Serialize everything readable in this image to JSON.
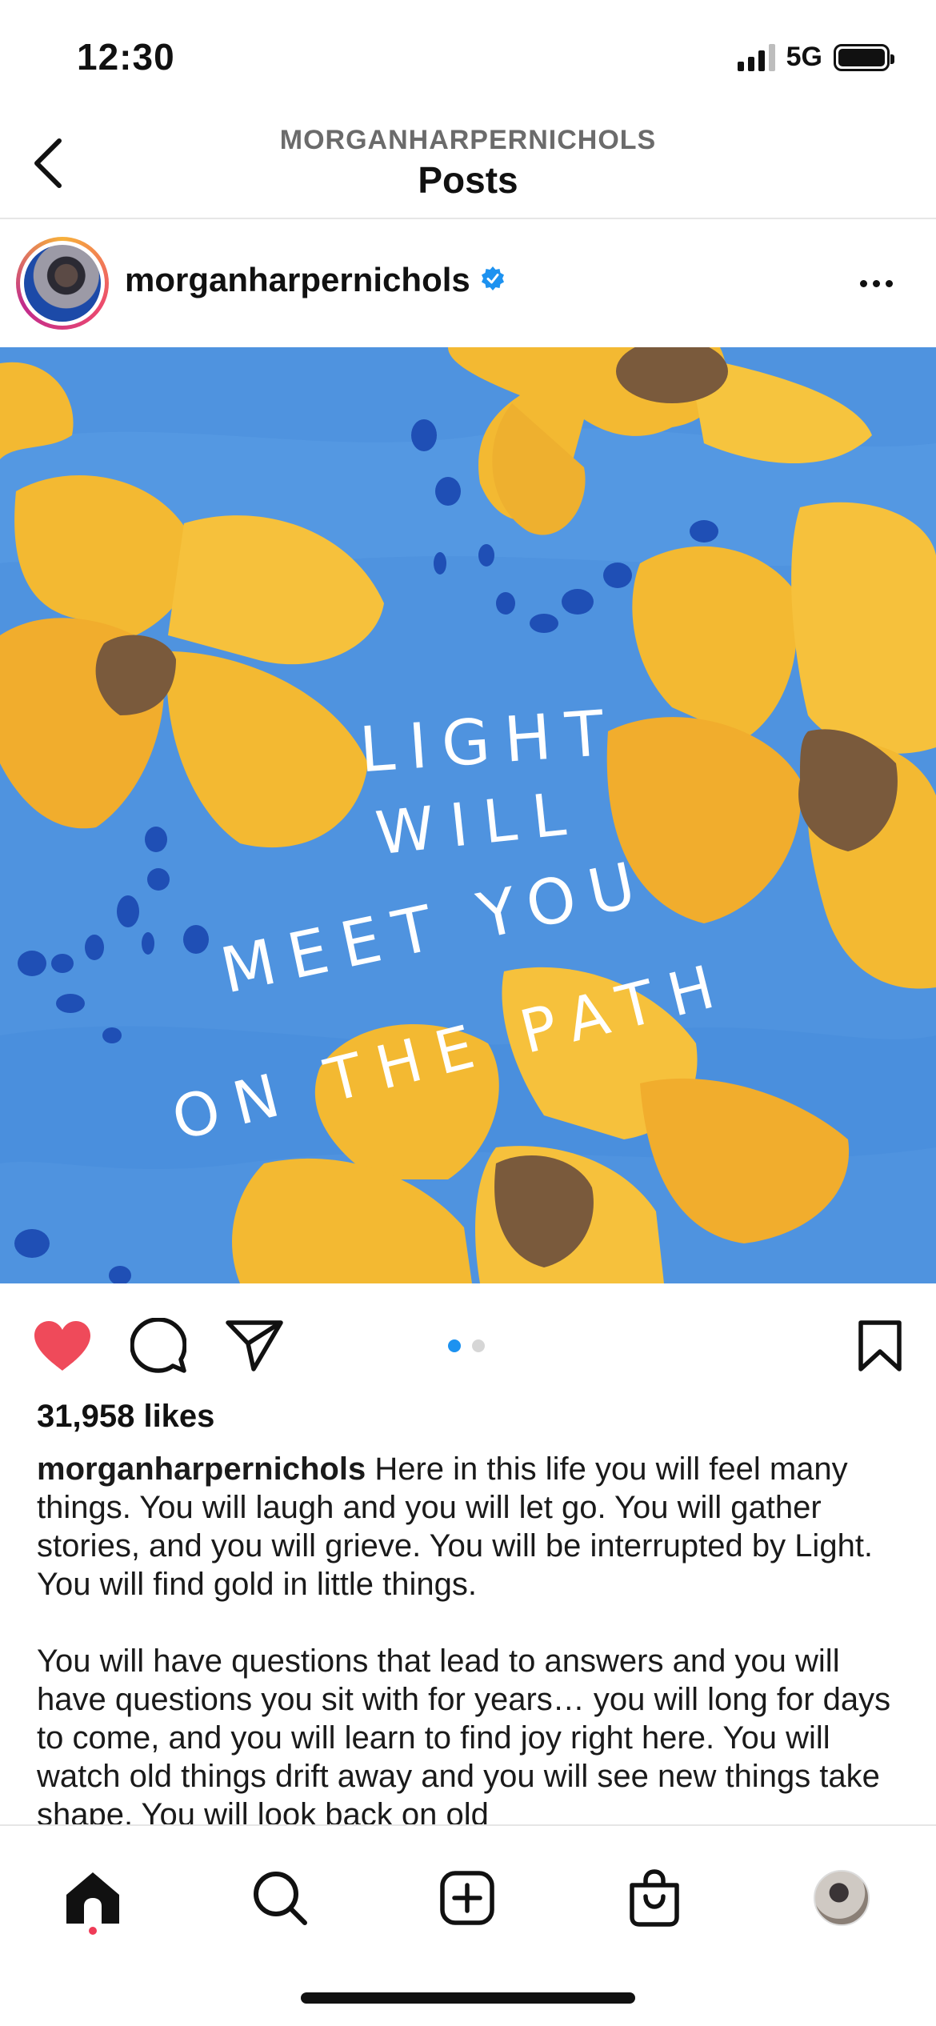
{
  "status_bar": {
    "time": "12:30",
    "network": "5G"
  },
  "header": {
    "subtitle": "MORGANHARPERNICHOLS",
    "title": "Posts",
    "back_icon": "chevron-left-icon"
  },
  "post": {
    "username": "morganharpernichols",
    "verified": true,
    "image_text_lines": [
      "LIGHT",
      "WILL",
      "MEET YOU",
      "ON THE PATH"
    ],
    "likes": "31,958 likes",
    "carousel": {
      "count": 2,
      "active": 0
    },
    "caption": {
      "username": "morganharpernichols",
      "paragraph1": "Here in this life you will feel many things. You will laugh and you will let go. You will gather stories, and you will grieve. You will be interrupted by Light. You will find gold in little things.",
      "paragraph2": "You will have questions that lead to answers and you will have questions you sit with for years… you will long for days to come, and you will learn to find joy right here. You will watch old things drift away and you will see new things take shape. You will look back on old"
    },
    "colors": {
      "like": "#ef4a5a",
      "accent_blue": "#1d92f0",
      "image_background": "#4f93df",
      "flower_yellow": "#f3b932",
      "flower_center": "#7a5a3c"
    }
  },
  "bottom_nav": {
    "items": [
      "home-icon",
      "search-icon",
      "create-icon",
      "shop-icon",
      "profile-avatar"
    ],
    "active": "home-icon"
  }
}
